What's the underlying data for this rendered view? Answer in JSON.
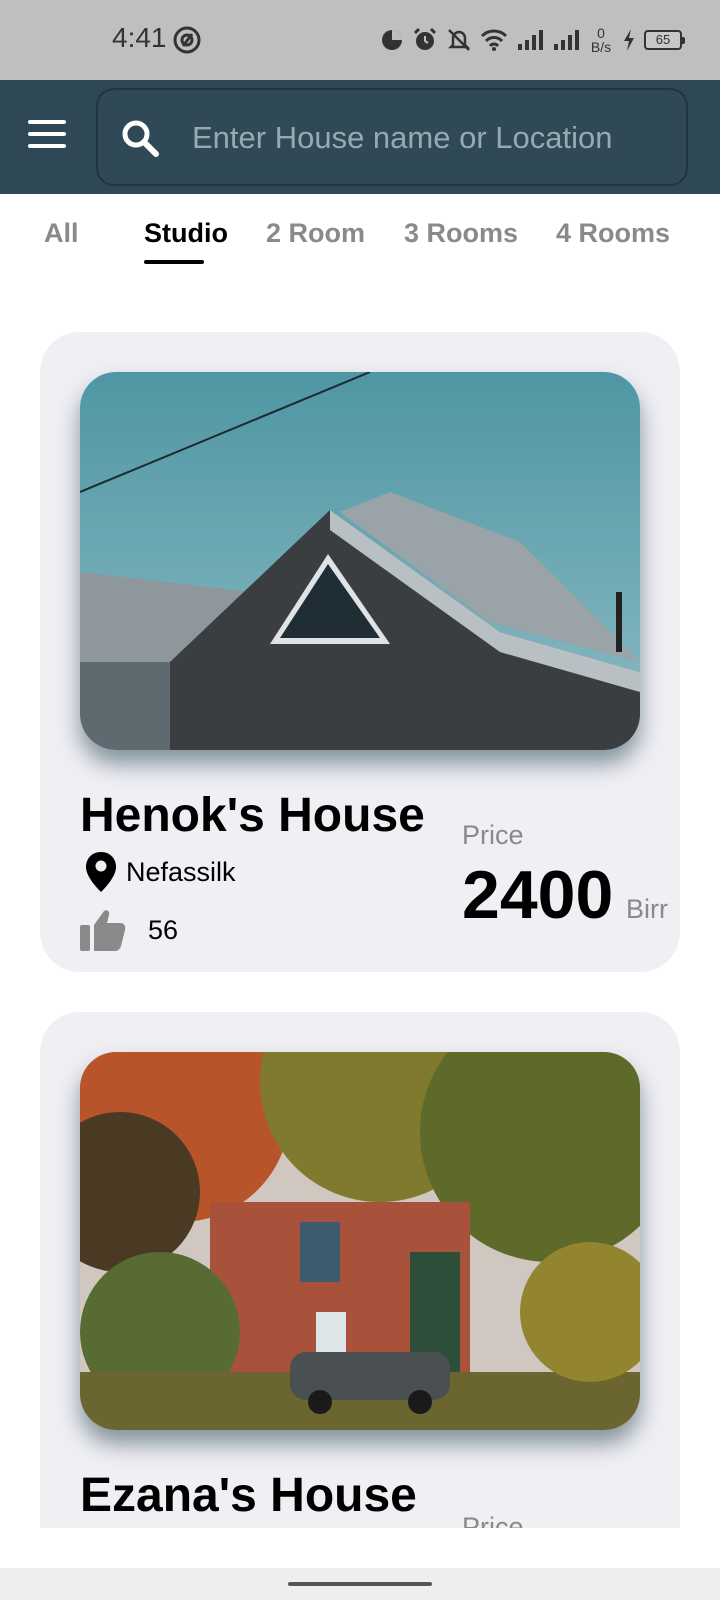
{
  "status_bar": {
    "time": "4:41",
    "net_speed_value": "0",
    "net_speed_unit": "B/s",
    "battery": "65"
  },
  "search": {
    "placeholder": "Enter House name or Location"
  },
  "tabs": [
    {
      "label": "All"
    },
    {
      "label": "Studio",
      "active": true
    },
    {
      "label": "2 Room"
    },
    {
      "label": "3 Rooms"
    },
    {
      "label": "4 Rooms"
    }
  ],
  "cards": [
    {
      "name": "Henok's House",
      "location": "Nefassilk",
      "likes": "56",
      "price_label": "Price",
      "price": "2400",
      "currency": "Birr"
    },
    {
      "name": "Ezana's House",
      "price_label": "Price"
    }
  ],
  "colors": {
    "header_bg": "#2e4856",
    "card_bg": "#efeff4",
    "tab_active": "#000000",
    "tab_inactive": "#8a8a8a"
  },
  "icons": [
    "menu-icon",
    "search-icon",
    "location-pin-icon",
    "thumbs-up-icon"
  ]
}
